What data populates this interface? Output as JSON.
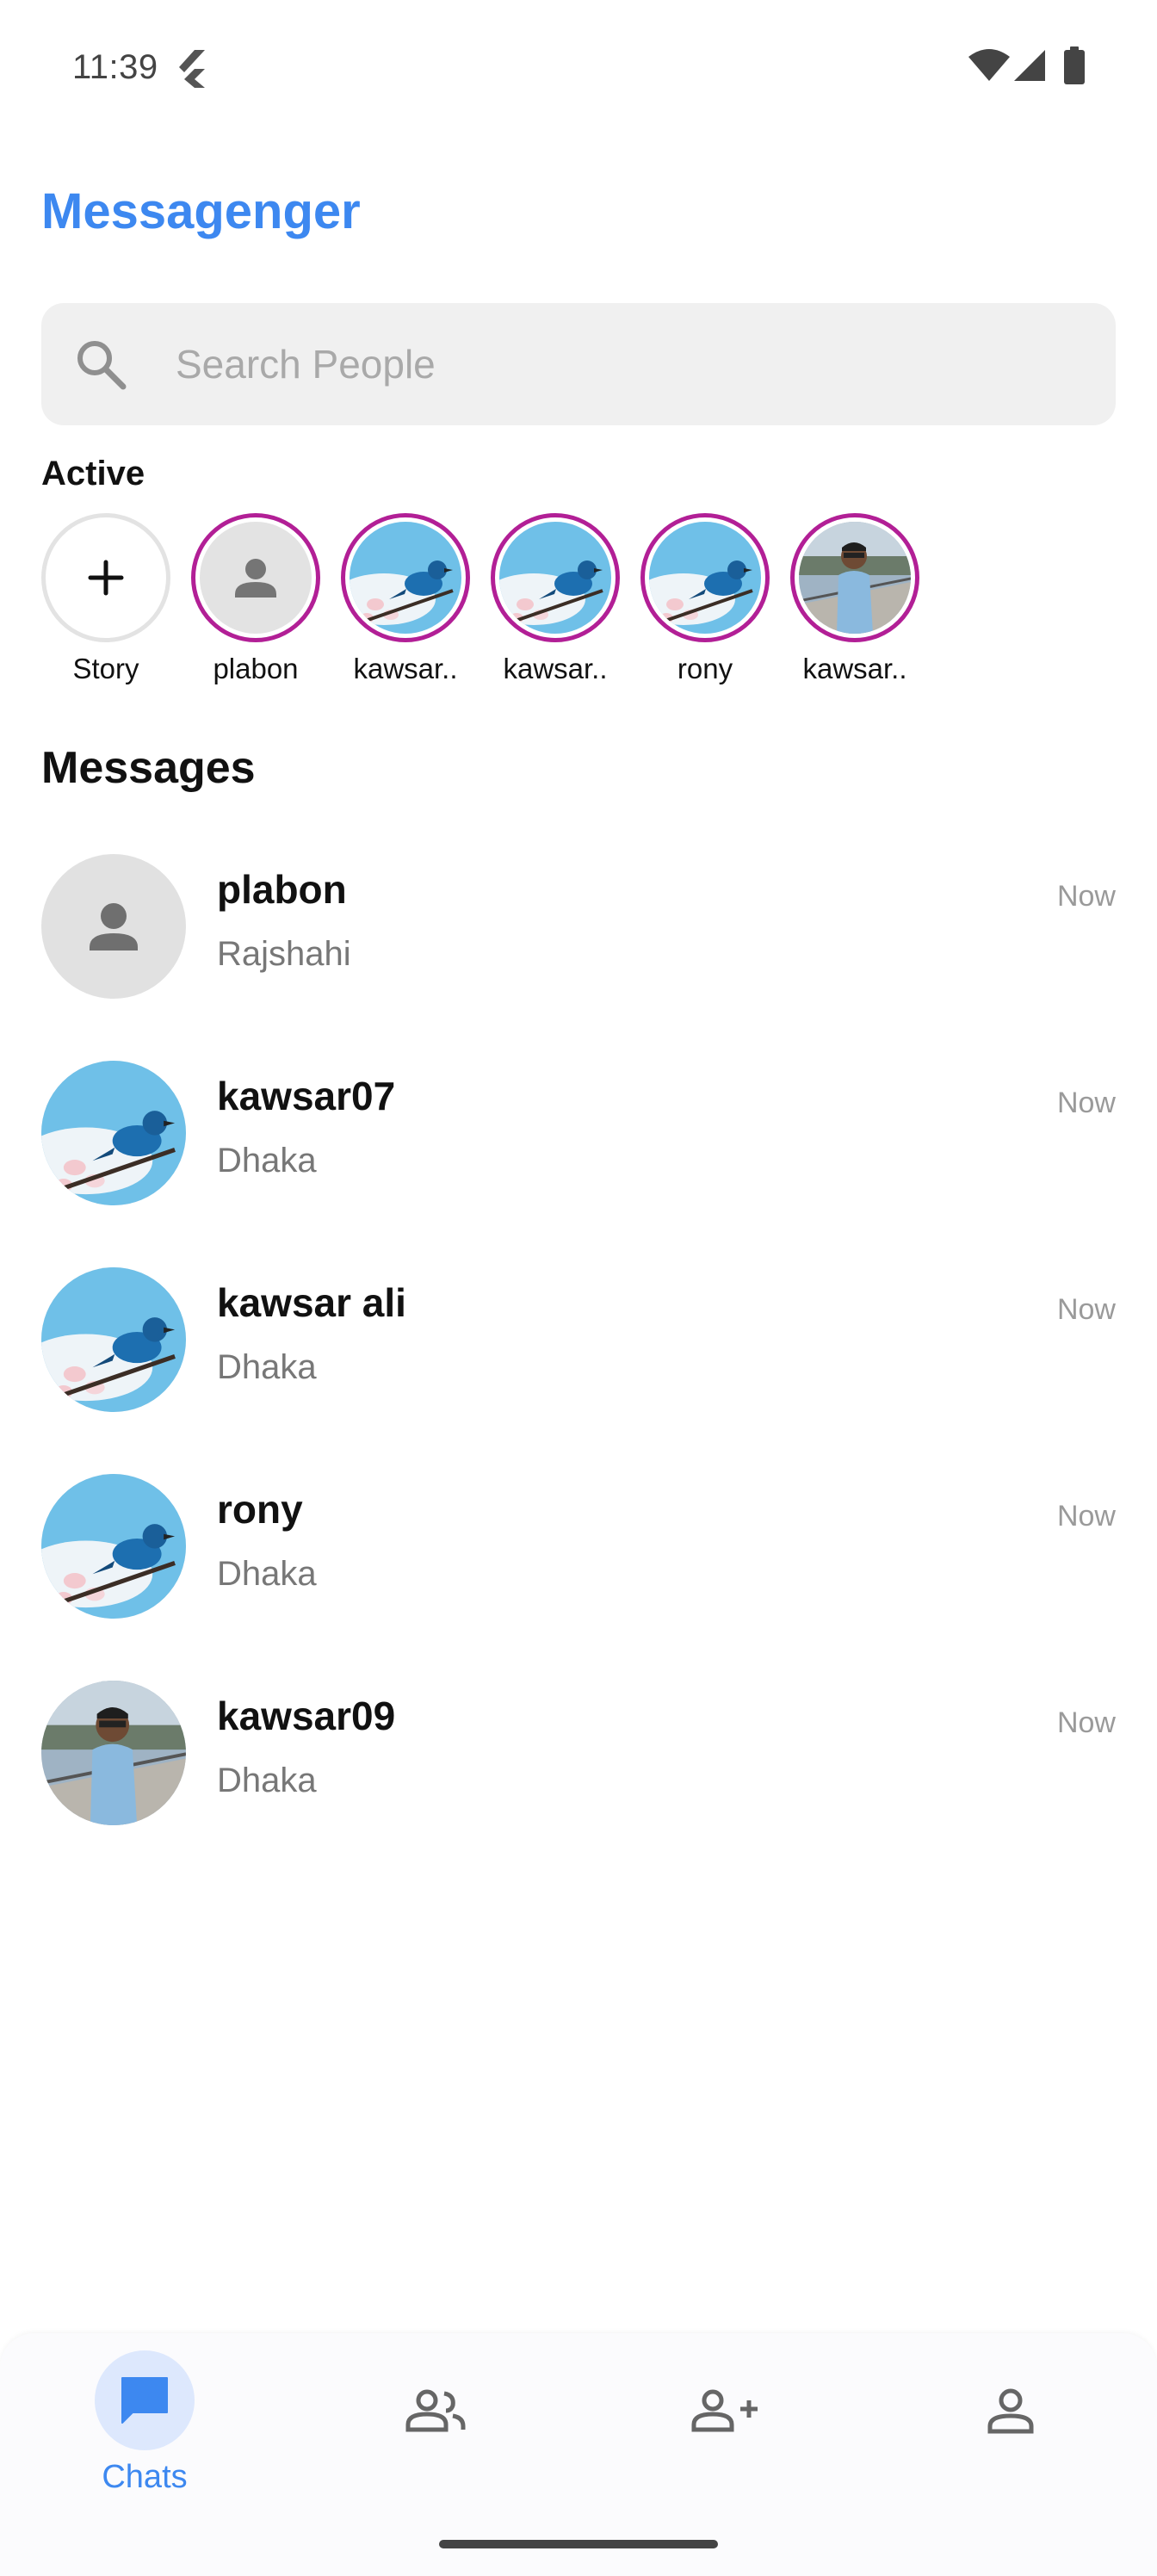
{
  "status_bar": {
    "time": "11:39"
  },
  "app": {
    "title": "Messagenger"
  },
  "search": {
    "placeholder": "Search People",
    "value": ""
  },
  "active": {
    "label": "Active",
    "items": [
      {
        "name": "Story",
        "type": "add"
      },
      {
        "name": "plabon",
        "type": "default"
      },
      {
        "name": "kawsar..",
        "type": "bird"
      },
      {
        "name": "kawsar..",
        "type": "bird"
      },
      {
        "name": "rony",
        "type": "bird"
      },
      {
        "name": "kawsar..",
        "type": "person"
      }
    ]
  },
  "messages": {
    "heading": "Messages",
    "items": [
      {
        "name": "plabon",
        "subtitle": "Rajshahi",
        "time": "Now",
        "avatar": "default"
      },
      {
        "name": "kawsar07",
        "subtitle": "Dhaka",
        "time": "Now",
        "avatar": "bird"
      },
      {
        "name": "kawsar ali",
        "subtitle": "Dhaka",
        "time": "Now",
        "avatar": "bird"
      },
      {
        "name": "rony",
        "subtitle": "Dhaka",
        "time": "Now",
        "avatar": "bird"
      },
      {
        "name": "kawsar09",
        "subtitle": "Dhaka",
        "time": "Now",
        "avatar": "person"
      }
    ]
  },
  "bottom_nav": {
    "items": [
      {
        "label": "Chats",
        "icon": "chat-icon",
        "active": true
      },
      {
        "label": "",
        "icon": "people-icon",
        "active": false
      },
      {
        "label": "",
        "icon": "add-friend-icon",
        "active": false
      },
      {
        "label": "",
        "icon": "profile-icon",
        "active": false
      }
    ]
  },
  "colors": {
    "accent": "#3d88f0",
    "story_ring": "#b21f96",
    "search_bg": "#f0f0f0",
    "nav_pill": "#dde8fd"
  }
}
